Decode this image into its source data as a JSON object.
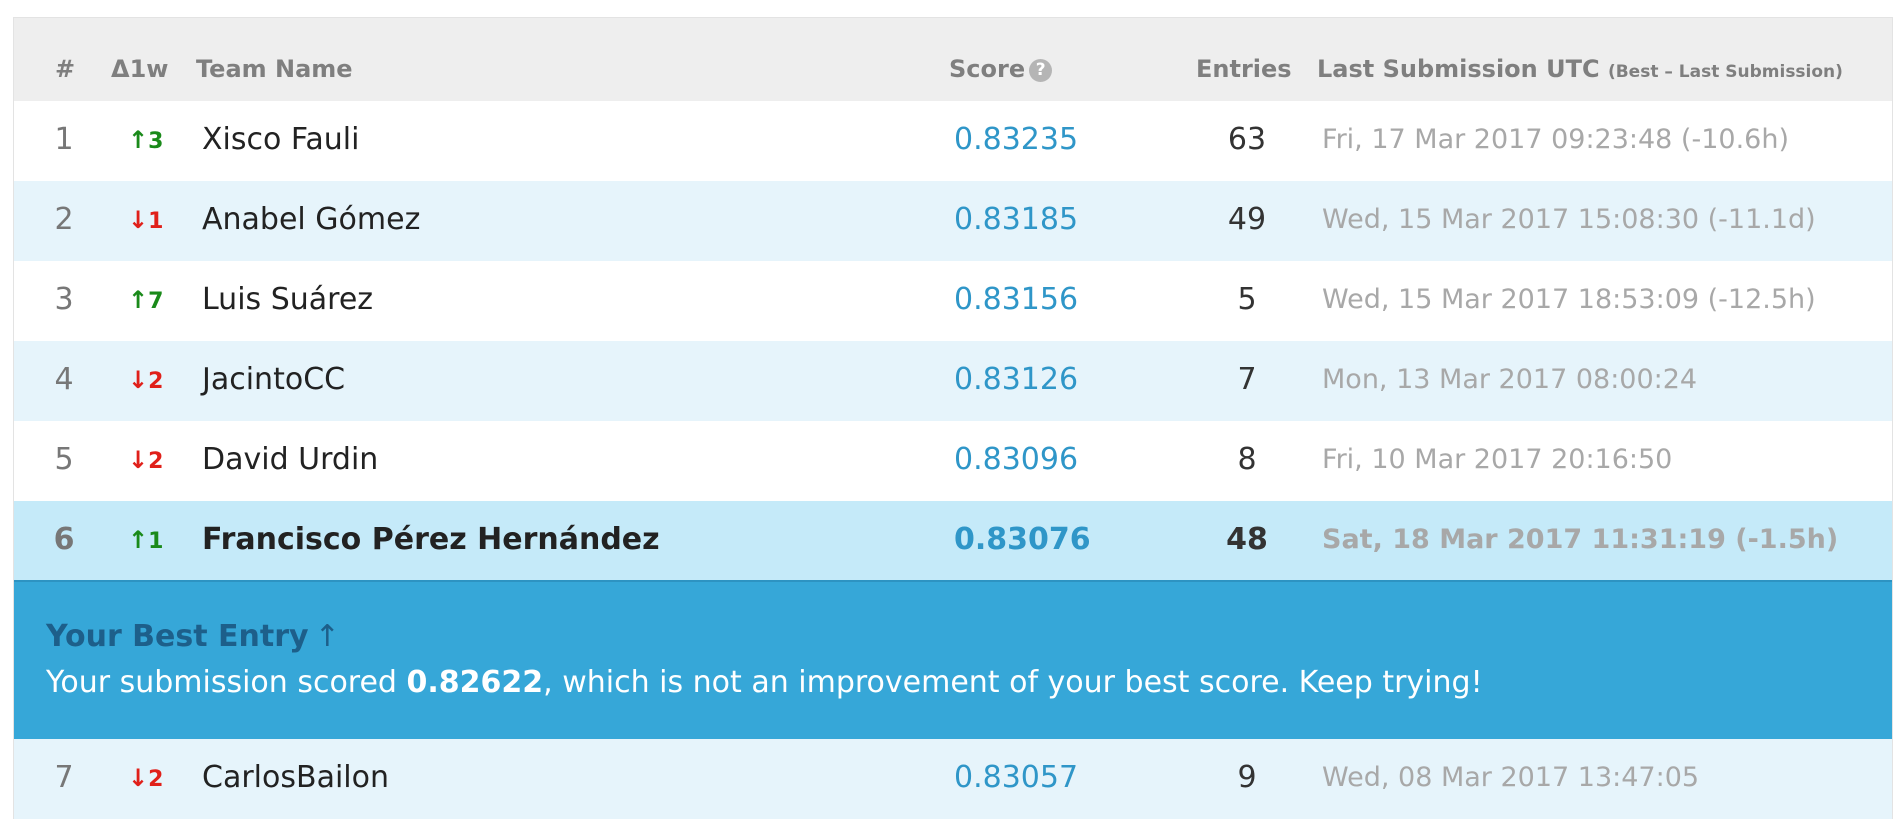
{
  "headers": {
    "rank": "#",
    "change": "Δ1w",
    "team": "Team Name",
    "score": "Score",
    "score_help": "?",
    "entries": "Entries",
    "last": "Last Submission UTC",
    "last_sub": "(Best – Last Submission)"
  },
  "rows": [
    {
      "rank": "1",
      "dir": "up",
      "arrow": "↑",
      "change": "3",
      "team": "Xisco Fauli",
      "score": "0.83235",
      "entries": "63",
      "last": "Fri, 17 Mar 2017 09:23:48 (-10.6h)"
    },
    {
      "rank": "2",
      "dir": "down",
      "arrow": "↓",
      "change": "1",
      "team": "Anabel Gómez",
      "score": "0.83185",
      "entries": "49",
      "last": "Wed, 15 Mar 2017 15:08:30 (-11.1d)"
    },
    {
      "rank": "3",
      "dir": "up",
      "arrow": "↑",
      "change": "7",
      "team": "Luis Suárez",
      "score": "0.83156",
      "entries": "5",
      "last": "Wed, 15 Mar 2017 18:53:09 (-12.5h)"
    },
    {
      "rank": "4",
      "dir": "down",
      "arrow": "↓",
      "change": "2",
      "team": "JacintoCC",
      "score": "0.83126",
      "entries": "7",
      "last": "Mon, 13 Mar 2017 08:00:24"
    },
    {
      "rank": "5",
      "dir": "down",
      "arrow": "↓",
      "change": "2",
      "team": "David Urdin",
      "score": "0.83096",
      "entries": "8",
      "last": "Fri, 10 Mar 2017 20:16:50"
    },
    {
      "rank": "6",
      "dir": "up",
      "arrow": "↑",
      "change": "1",
      "team": "Francisco Pérez Hernández",
      "score": "0.83076",
      "entries": "48",
      "last": "Sat, 18 Mar 2017 11:31:19 (-1.5h)"
    },
    {
      "rank": "7",
      "dir": "down",
      "arrow": "↓",
      "change": "2",
      "team": "CarlosBailon",
      "score": "0.83057",
      "entries": "9",
      "last": "Wed, 08 Mar 2017 13:47:05"
    }
  ],
  "banner": {
    "title": "Your Best Entry",
    "title_arrow": "↑",
    "msg_before": "Your submission scored ",
    "msg_score": "0.82622",
    "msg_after": ", which is not an improvement of your best score. Keep trying!"
  },
  "colors": {
    "header_bg": "#eeeeee",
    "row_alt_bg": "#e6f4fb",
    "current_row_bg": "#c5eaf9",
    "banner_bg": "#36a7d8",
    "banner_title": "#1d5f8a",
    "score_text": "#2f96c8",
    "up": "#1a8a1a",
    "down": "#e0201a"
  },
  "icons": {
    "score_help": "help-circle-icon",
    "up": "arrow-up-icon",
    "down": "arrow-down-icon"
  }
}
